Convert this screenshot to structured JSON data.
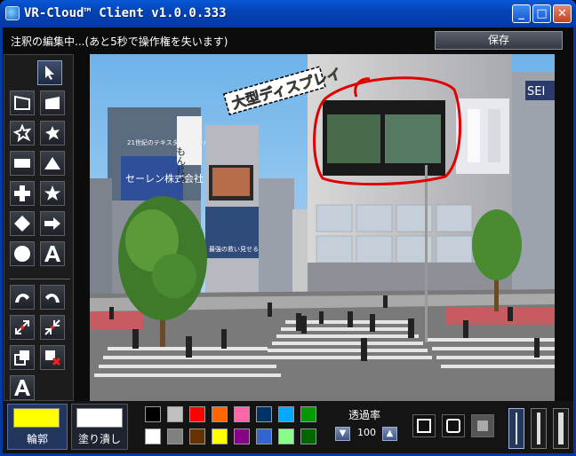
{
  "window": {
    "title": "VR-Cloud™ Client v1.0.0.333",
    "minimize_icon": "minimize-icon",
    "maximize_icon": "maximize-icon",
    "close_icon": "close-icon"
  },
  "header": {
    "status": "注釈の編集中...(あと5秒で操作権を失います)",
    "save_label": "保存"
  },
  "toolbar": {
    "tools": [
      "select-arrow-icon",
      "perspective-outline-icon",
      "perspective-filled-icon",
      "star-burst-outline-icon",
      "star-burst-filled-icon",
      "rectangle-icon",
      "triangle-icon",
      "cross-icon",
      "star-icon",
      "diamond-icon",
      "arrow-right-icon",
      "circle-icon",
      "text-icon",
      "curve-left-icon",
      "curve-right-icon",
      "scale-expand-icon",
      "scale-shrink-icon",
      "bring-front-icon",
      "delete-icon",
      "text-small-icon"
    ]
  },
  "viewport": {
    "annotation_text": "大型ディスプレイ",
    "billboard_left_text": "セーレン株式会社",
    "billboard_left_sub": "21世紀のテキスタイルカンパニーへ",
    "sign_text": "もんじゃ",
    "poster_text": "最強の救い見せる",
    "sign_right": "SEI"
  },
  "bottombar": {
    "outline_label": "輪郭",
    "fill_label": "塗り潰し",
    "outline_color": "#ffff00",
    "fill_color": "#ffffff",
    "palette_top": [
      "#000000",
      "#c0c0c0",
      "#ff0000",
      "#ff6600",
      "#ff66aa",
      "#003366",
      "#00aaff",
      "#009900"
    ],
    "palette_bottom": [
      "#ffffff",
      "#808080",
      "#663300",
      "#ffff00",
      "#880088",
      "#3366cc",
      "#88ff88",
      "#006600"
    ],
    "opacity_label": "透過率",
    "opacity_value": "100"
  }
}
